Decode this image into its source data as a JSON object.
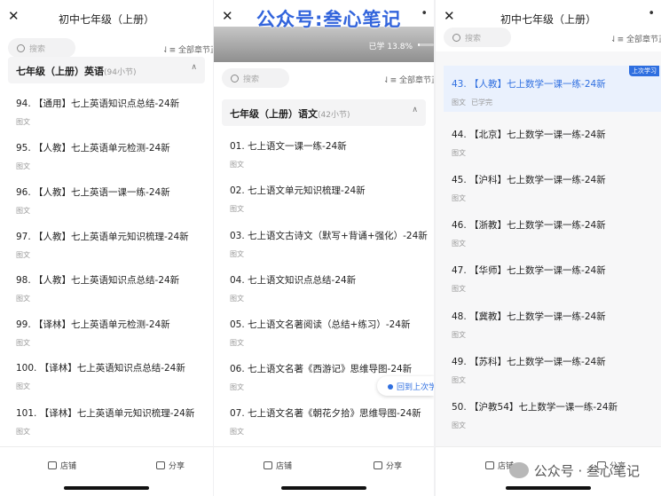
{
  "common": {
    "title": "初中七年级（上册）",
    "search_placeholder": "搜索",
    "all_chapters": "全部章节正",
    "item_type": "图文",
    "store": "店铺",
    "share": "分享"
  },
  "panel1": {
    "group": {
      "title": "七年级（上册）英语",
      "count": "(94小节)"
    },
    "items": [
      {
        "title": "94. 【通用】七上英语知识点总结-24新"
      },
      {
        "title": "95. 【人教】七上英语单元检测-24新"
      },
      {
        "title": "96. 【人教】七上英语一课一练-24新"
      },
      {
        "title": "97. 【人教】七上英语单元知识梳理-24新"
      },
      {
        "title": "98. 【人教】七上英语知识点总结-24新"
      },
      {
        "title": "99. 【译林】七上英语单元检测-24新"
      },
      {
        "title": "100. 【译林】七上英语知识点总结-24新"
      },
      {
        "title": "101. 【译林】七上英语单元知识梳理-24新"
      }
    ]
  },
  "panel2": {
    "watermark": "公众号:叁心笔记",
    "progress": {
      "label": "已学 13.8%",
      "value": 13.8
    },
    "group": {
      "title": "七年级（上册）语文",
      "count": "(42小节)"
    },
    "items": [
      {
        "title": "01. 七上语文一课一练-24新"
      },
      {
        "title": "02. 七上语文单元知识梳理-24新"
      },
      {
        "title": "03. 七上语文古诗文（默写+背诵+强化）-24新"
      },
      {
        "title": "04. 七上语文知识点总结-24新"
      },
      {
        "title": "05. 七上语文名著阅读（总结+练习）-24新"
      },
      {
        "title": "06. 七上语文名著《西游记》思维导图-24新"
      },
      {
        "title": "07. 七上语文名著《朝花夕拾》思维导图-24新"
      }
    ],
    "goto_last": "回到上次学"
  },
  "panel3": {
    "highlight": {
      "title": "43. 【人教】七上数学一课一练-24新",
      "status": "已学完",
      "badge": "上次学习"
    },
    "items": [
      {
        "title": "44. 【北京】七上数学一课一练-24新"
      },
      {
        "title": "45. 【沪科】七上数学一课一练-24新"
      },
      {
        "title": "46. 【浙教】七上数学一课一练-24新"
      },
      {
        "title": "47. 【华师】七上数学一课一练-24新"
      },
      {
        "title": "48. 【冀教】七上数学一课一练-24新"
      },
      {
        "title": "49. 【苏科】七上数学一课一练-24新"
      },
      {
        "title": "50. 【沪教54】七上数学一课一练-24新"
      }
    ],
    "footer_watermark": "公众号 · 叁心笔记"
  },
  "colors": {
    "accent": "#2f6fe0",
    "watermark": "#3264dc"
  },
  "icons": [
    "close-icon",
    "more-icon",
    "search-icon",
    "sort-icon",
    "chevron-up-icon",
    "store-icon",
    "share-icon",
    "location-pin-icon"
  ]
}
